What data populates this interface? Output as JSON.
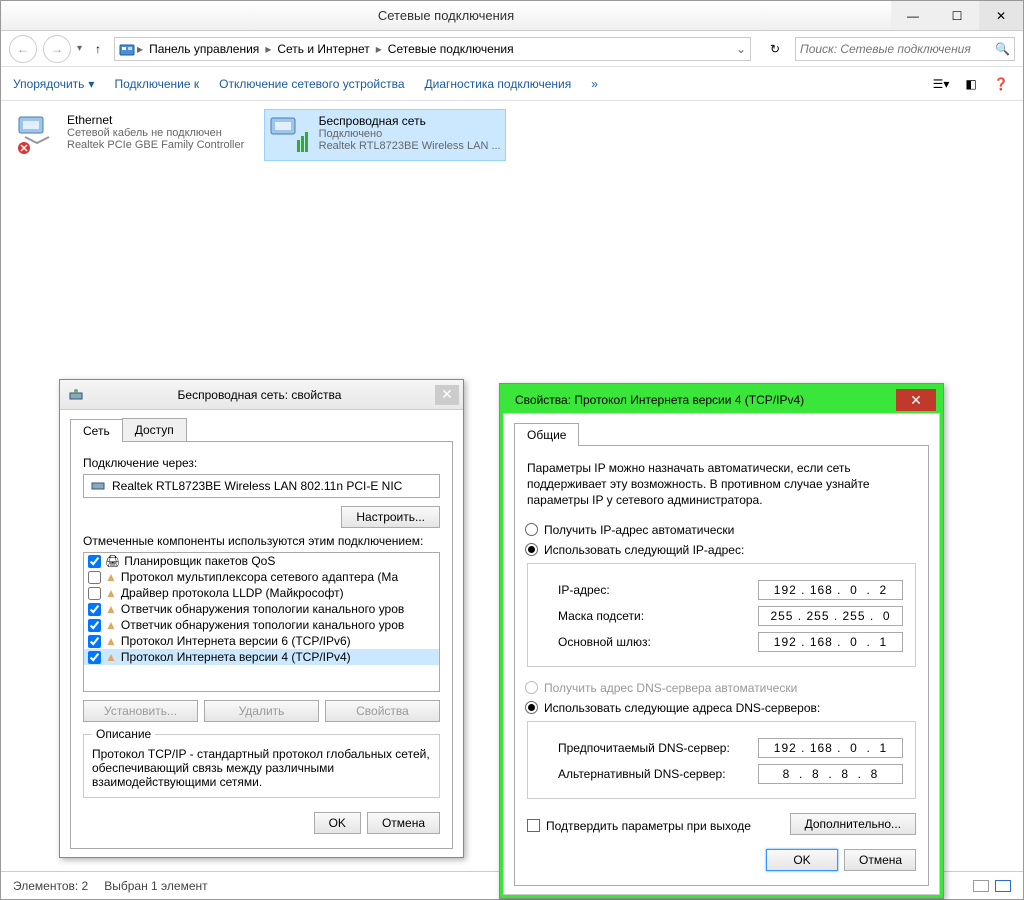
{
  "window": {
    "title": "Сетевые подключения",
    "breadcrumb": [
      "Панель управления",
      "Сеть и Интернет",
      "Сетевые подключения"
    ],
    "search_placeholder": "Поиск: Сетевые подключения"
  },
  "toolbar": {
    "organize": "Упорядочить",
    "connect": "Подключение к",
    "disable": "Отключение сетевого устройства",
    "diagnose": "Диагностика подключения",
    "overflow": "»"
  },
  "connections": [
    {
      "name": "Ethernet",
      "status": "Сетевой кабель не подключен",
      "device": "Realtek PCIe GBE Family Controller",
      "selected": false,
      "disconnected": true
    },
    {
      "name": "Беспроводная сеть",
      "status": "Подключено",
      "device": "Realtek RTL8723BE Wireless LAN ...",
      "selected": true,
      "disconnected": false
    }
  ],
  "props_dialog": {
    "title": "Беспроводная сеть: свойства",
    "tab_network": "Сеть",
    "tab_access": "Доступ",
    "connect_via": "Подключение через:",
    "adapter": "Realtek RTL8723BE Wireless LAN 802.11n PCI-E NIC",
    "configure": "Настроить...",
    "components_label": "Отмеченные компоненты используются этим подключением:",
    "components": [
      {
        "checked": true,
        "label": "Планировщик пакетов QoS"
      },
      {
        "checked": false,
        "label": "Протокол мультиплексора сетевого адаптера (Ма"
      },
      {
        "checked": false,
        "label": "Драйвер протокола LLDP (Майкрософт)"
      },
      {
        "checked": true,
        "label": "Ответчик обнаружения топологии канального уров"
      },
      {
        "checked": true,
        "label": "Ответчик обнаружения топологии канального уров"
      },
      {
        "checked": true,
        "label": "Протокол Интернета версии 6 (TCP/IPv6)"
      },
      {
        "checked": true,
        "label": "Протокол Интернета версии 4 (TCP/IPv4)"
      }
    ],
    "install": "Установить...",
    "remove": "Удалить",
    "properties": "Свойства",
    "description_title": "Описание",
    "description_text": "Протокол TCP/IP - стандартный протокол глобальных сетей, обеспечивающий связь между различными взаимодействующими сетями.",
    "ok": "OK",
    "cancel": "Отмена"
  },
  "ipv4_dialog": {
    "title": "Свойства: Протокол Интернета версии 4 (TCP/IPv4)",
    "tab_general": "Общие",
    "description": "Параметры IP можно назначать автоматически, если сеть поддерживает эту возможность. В противном случае узнайте параметры IP у сетевого администратора.",
    "radio_auto_ip": "Получить IP-адрес автоматически",
    "radio_manual_ip": "Использовать следующий IP-адрес:",
    "ip_label": "IP-адрес:",
    "ip_value": "192 . 168 .  0  .  2",
    "mask_label": "Маска подсети:",
    "mask_value": "255 . 255 . 255 .  0",
    "gateway_label": "Основной шлюз:",
    "gateway_value": "192 . 168 .  0  .  1",
    "radio_auto_dns": "Получить адрес DNS-сервера автоматически",
    "radio_manual_dns": "Использовать следующие адреса DNS-серверов:",
    "dns1_label": "Предпочитаемый DNS-сервер:",
    "dns1_value": "192 . 168 .  0  .  1",
    "dns2_label": "Альтернативный DNS-сервер:",
    "dns2_value": "8  .  8  .  8  .  8",
    "validate_checkbox": "Подтвердить параметры при выходе",
    "advanced": "Дополнительно...",
    "ok": "OK",
    "cancel": "Отмена"
  },
  "statusbar": {
    "items": "Элементов: 2",
    "selected": "Выбран 1 элемент"
  }
}
